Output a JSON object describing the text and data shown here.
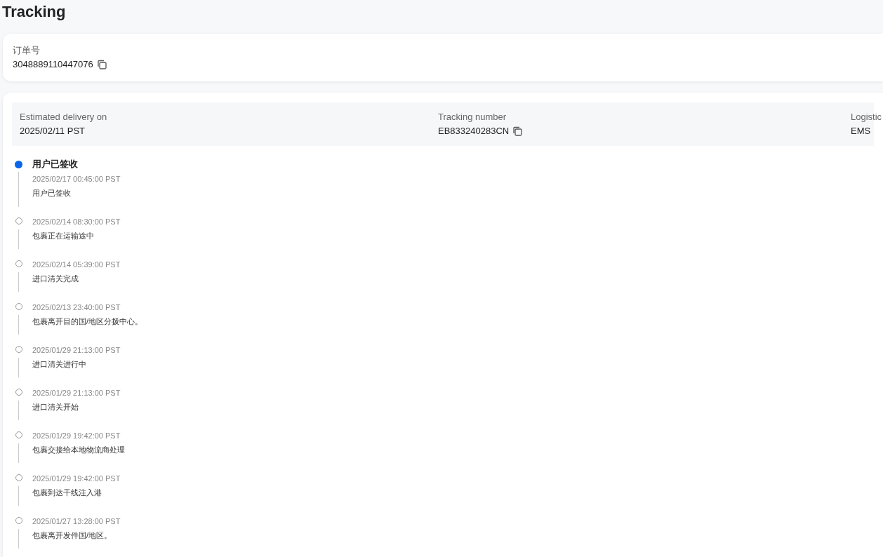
{
  "page_title": "Tracking",
  "order": {
    "label": "订单号",
    "value": "3048889110447076"
  },
  "summary": [
    {
      "label": "Estimated delivery on",
      "value": "2025/02/11 PST",
      "copyable": false
    },
    {
      "label": "Tracking number",
      "value": "EB833240283CN",
      "copyable": true
    },
    {
      "label": "Logistic",
      "value": "EMS",
      "copyable": false
    }
  ],
  "events": [
    {
      "title": "用户已签收",
      "time": "2025/02/17 00:45:00 PST",
      "description": "用户已签收",
      "active": true
    },
    {
      "time": "2025/02/14 08:30:00 PST",
      "description": "包裹正在运输途中",
      "active": false
    },
    {
      "time": "2025/02/14 05:39:00 PST",
      "description": "进口清关完成",
      "active": false
    },
    {
      "time": "2025/02/13 23:40:00 PST",
      "description": "包裹离开目的国/地区分拨中心。",
      "active": false
    },
    {
      "time": "2025/01/29 21:13:00 PST",
      "description": "进口清关进行中",
      "active": false
    },
    {
      "time": "2025/01/29 21:13:00 PST",
      "description": "进口清关开始",
      "active": false
    },
    {
      "time": "2025/01/29 19:42:00 PST",
      "description": "包裹交接给本地物流商处理",
      "active": false
    },
    {
      "time": "2025/01/29 19:42:00 PST",
      "description": "包裹到达干线注入港",
      "active": false
    },
    {
      "time": "2025/01/27 13:28:00 PST",
      "description": "包裹离开发件国/地区。",
      "active": false
    }
  ]
}
